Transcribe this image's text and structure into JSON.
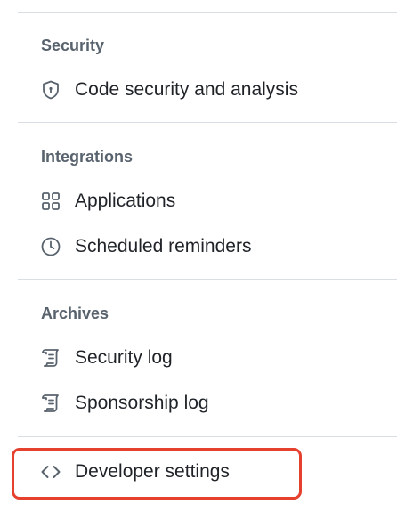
{
  "sections": {
    "security": {
      "heading": "Security",
      "items": [
        {
          "label": "Code security and analysis",
          "icon": "shield-lock-icon"
        }
      ]
    },
    "integrations": {
      "heading": "Integrations",
      "items": [
        {
          "label": "Applications",
          "icon": "apps-grid-icon"
        },
        {
          "label": "Scheduled reminders",
          "icon": "clock-icon"
        }
      ]
    },
    "archives": {
      "heading": "Archives",
      "items": [
        {
          "label": "Security log",
          "icon": "log-icon"
        },
        {
          "label": "Sponsorship log",
          "icon": "log-icon"
        }
      ]
    }
  },
  "developer": {
    "label": "Developer settings",
    "icon": "code-icon"
  },
  "colors": {
    "text": "#1f2328",
    "muted": "#59636e",
    "divider": "#d8dee4",
    "highlight": "#e5412e"
  }
}
